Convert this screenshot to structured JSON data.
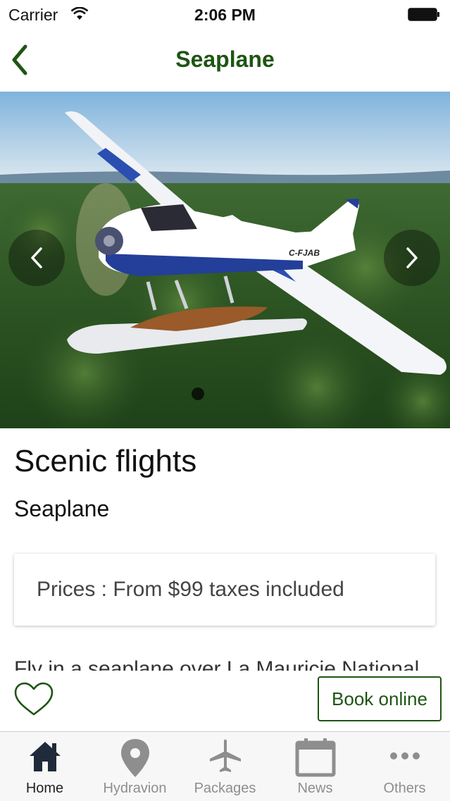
{
  "status_bar": {
    "carrier": "Carrier",
    "time": "2:06 PM"
  },
  "nav": {
    "title": "Seaplane",
    "back_icon": "chevron-left-icon"
  },
  "hero": {
    "aircraft_registration": "C-FJAB",
    "description_image": "seaplane-over-forest"
  },
  "content": {
    "heading": "Scenic flights",
    "subheading": "Seaplane",
    "price": "Prices : From $99 taxes included",
    "description": "Fly in a seaplane over La Mauricie National"
  },
  "actions": {
    "book_label": "Book online",
    "favorite_icon": "heart-icon"
  },
  "tabs": [
    {
      "label": "Home",
      "icon": "home-icon",
      "active": true
    },
    {
      "label": "Hydravion",
      "icon": "map-pin-icon",
      "active": false
    },
    {
      "label": "Packages",
      "icon": "airplane-icon",
      "active": false
    },
    {
      "label": "News",
      "icon": "calendar-icon",
      "active": false
    },
    {
      "label": "Others",
      "icon": "more-icon",
      "active": false
    }
  ],
  "colors": {
    "accent": "#1e5514",
    "tab_inactive": "#8e8e8e",
    "tab_active": "#222222"
  }
}
